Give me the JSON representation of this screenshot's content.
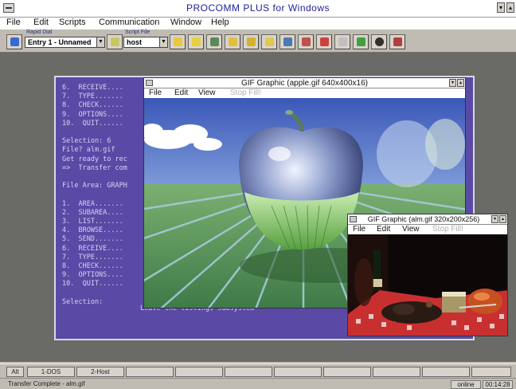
{
  "app": {
    "title": "PROCOMM PLUS for Windows"
  },
  "menubar": {
    "items": [
      "File",
      "Edit",
      "Scripts",
      "Communication",
      "Window",
      "Help"
    ]
  },
  "toolbar": {
    "rapid_dial_label": "Rapid Dial",
    "rapid_dial_value": "Entry 1 - Unnamed",
    "script_file_label": "Script File",
    "script_file_value": "host"
  },
  "terminal": {
    "lines": [
      "6.  RECEIVE....",
      "7.  TYPE.......",
      "8.  CHECK......",
      "9.  OPTIONS....",
      "10.  QUIT......",
      "",
      "Selection: 6",
      "File? alm.gif",
      "Get ready to rec",
      "=>  Transfer com",
      "",
      "File Area: GRAPH",
      "",
      "1.  AREA.......",
      "2.  SUBAREA....",
      "3.  LIST.......",
      "4.  BROWSE.....",
      "5.  SEND.......",
      "6.  RECEIVE....",
      "7.  TYPE.......",
      "8.  CHECK......",
      "9.  OPTIONS....",
      "10.  QUIT......",
      "",
      "Selection:"
    ],
    "quit_description": "Leave the listings subsystem"
  },
  "gif_window_1": {
    "title": "GIF Graphic (apple.gif 640x400x16)",
    "menu": [
      "File",
      "Edit",
      "View",
      "Stop Fill!"
    ]
  },
  "gif_window_2": {
    "title": "GIF Graphic (alm.gif 320x200x256)",
    "menu": [
      "File",
      "Edit",
      "View",
      "Stop Fill!"
    ]
  },
  "fkeys": {
    "items": [
      "Alt",
      "1-DOS",
      "2-Host"
    ]
  },
  "statusbar": {
    "message": "Transfer Complete - alm.gif",
    "connection": "online",
    "time": "00:14:28"
  },
  "colors": {
    "terminal_bg": "#5a4aa6",
    "title_text": "#1e1e9a"
  }
}
